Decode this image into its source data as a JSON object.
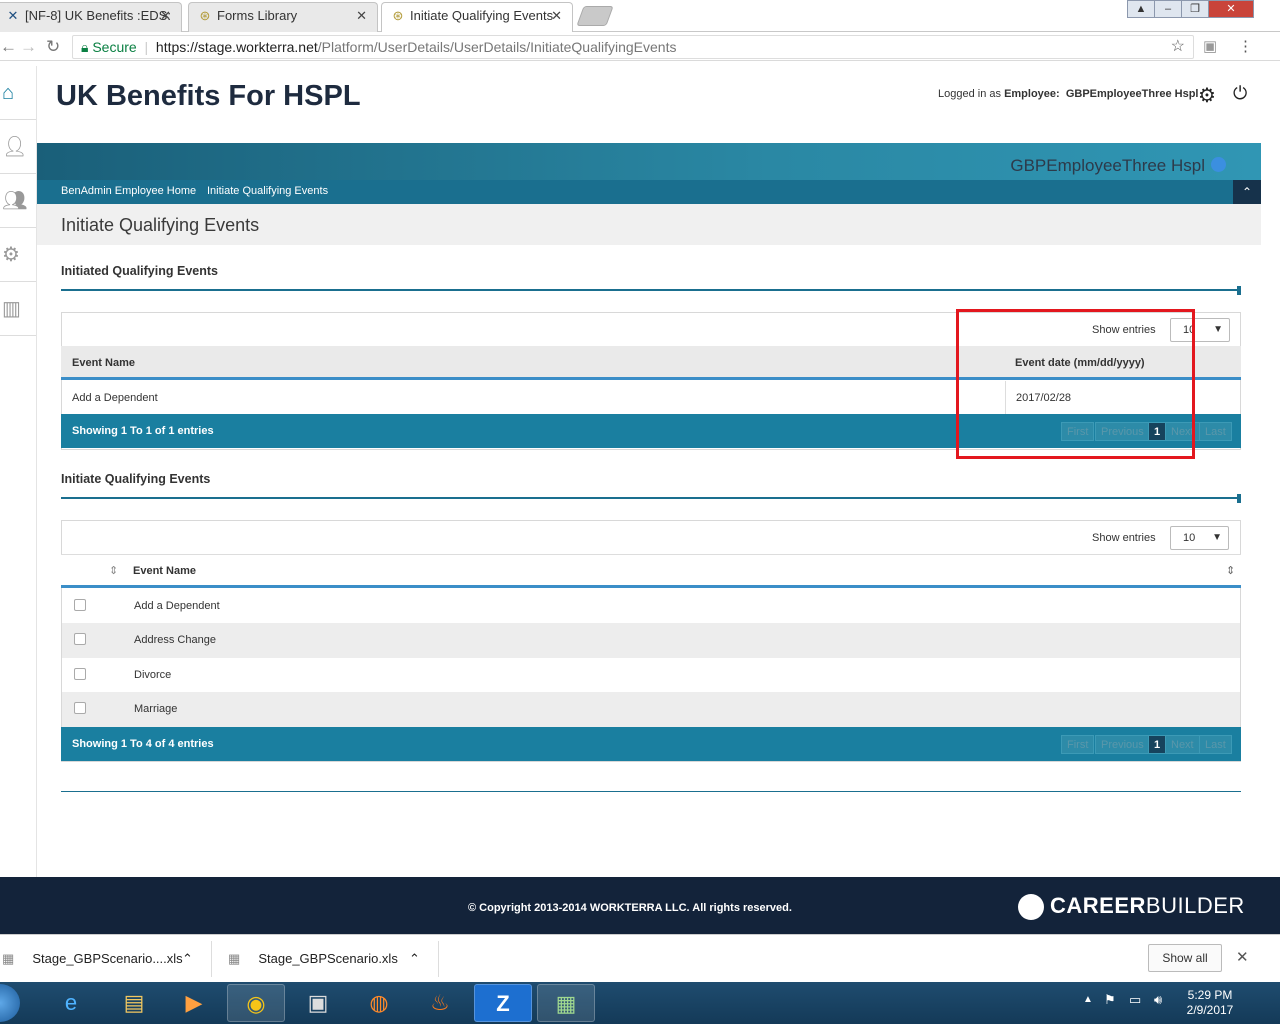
{
  "browser": {
    "tabs": [
      {
        "title": "[NF-8] UK Benefits :EDS: ",
        "icon": "jira-icon"
      },
      {
        "title": "Forms Library",
        "icon": "globe-icon"
      },
      {
        "title": "Initiate Qualifying Events",
        "icon": "globe-icon"
      }
    ],
    "url_secure": "Secure",
    "url_host": "https://stage.workterra.net",
    "url_path": "/Platform/UserDetails/UserDetails/InitiateQualifyingEvents"
  },
  "header": {
    "title": "UK Benefits For HSPL",
    "logged_in_prefix": "Logged in as ",
    "logged_in_role": "Employee:",
    "logged_in_user": "GBPEmployeeThree Hspl"
  },
  "banner": {
    "name": "GBPEmployeeThree Hspl"
  },
  "breadcrumb": [
    "BenAdmin Employee Home",
    "Initiate Qualifying Events"
  ],
  "page": {
    "title": "Initiate Qualifying Events"
  },
  "initiated": {
    "title": "Initiated Qualifying Events",
    "show_entries_label": "Show entries",
    "show_entries_value": "10",
    "columns": [
      "Event Name",
      "Event date (mm/dd/yyyy)"
    ],
    "rows": [
      {
        "event": "Add a Dependent",
        "date": "2017/02/28"
      }
    ],
    "footer_info": "Showing 1 To 1 of 1 entries",
    "pagination": [
      "First",
      "Previous",
      "1",
      "Next",
      "Last"
    ]
  },
  "initiate": {
    "title": "Initiate Qualifying Events",
    "show_entries_label": "Show entries",
    "show_entries_value": "10",
    "column": "Event Name",
    "rows": [
      "Add a Dependent",
      "Address Change",
      "Divorce",
      "Marriage"
    ],
    "footer_info": "Showing 1 To 4 of 4 entries",
    "pagination": [
      "First",
      "Previous",
      "1",
      "Next",
      "Last"
    ]
  },
  "footer": {
    "copyright": "© Copyright 2013-2014 WORKTERRA LLC. All rights reserved.",
    "logo_bold": "CAREER",
    "logo_thin": "BUILDER"
  },
  "downloads": {
    "items": [
      "Stage_GBPScenario....xls",
      "Stage_GBPScenario.xls"
    ],
    "show_all": "Show all"
  },
  "taskbar": {
    "time": "5:29 PM",
    "date": "2/9/2017"
  },
  "colors": {
    "teal": "#1a7fa0",
    "navy": "#13233a",
    "highlight": "#e3171e"
  }
}
